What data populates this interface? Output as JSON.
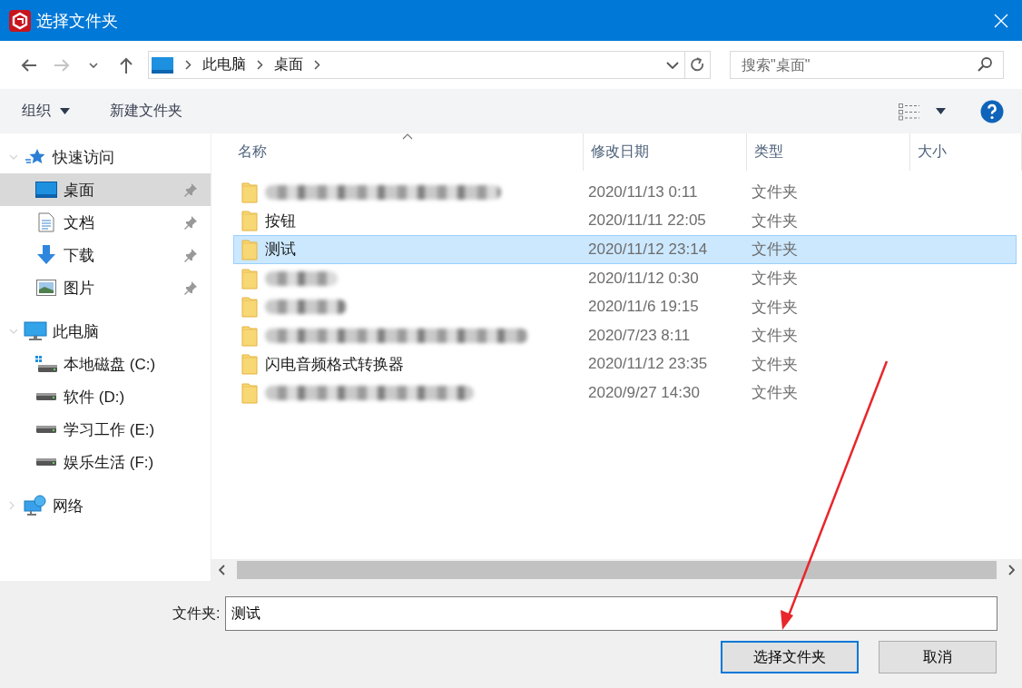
{
  "window": {
    "title": "选择文件夹"
  },
  "navigation": {
    "buttons": [
      {
        "kind": "back",
        "disabled": false
      },
      {
        "kind": "forward",
        "disabled": true
      },
      {
        "kind": "recent",
        "disabled": false
      },
      {
        "kind": "up",
        "disabled": false
      }
    ],
    "breadcrumb": [
      "此电脑",
      "桌面"
    ],
    "search": {
      "placeholder": "搜索\"桌面\""
    }
  },
  "toolbar": {
    "organize": "组织",
    "new_folder": "新建文件夹"
  },
  "sidebar": {
    "items": [
      {
        "label": "快速访问",
        "kind": "quick",
        "expanded": true,
        "selected": false,
        "children": [
          {
            "label": "桌面",
            "kind": "desktop",
            "selected": true,
            "pinned": true
          },
          {
            "label": "文档",
            "kind": "document",
            "selected": false,
            "pinned": true
          },
          {
            "label": "下载",
            "kind": "download",
            "selected": false,
            "pinned": true
          },
          {
            "label": "图片",
            "kind": "picture",
            "selected": false,
            "pinned": true
          }
        ]
      },
      {
        "label": "此电脑",
        "kind": "pc",
        "expanded": true,
        "selected": false,
        "children": [
          {
            "label": "本地磁盘 (C:)",
            "kind": "system-drive",
            "selected": false
          },
          {
            "label": "软件 (D:)",
            "kind": "drive",
            "selected": false
          },
          {
            "label": "学习工作 (E:)",
            "kind": "drive",
            "selected": false
          },
          {
            "label": "娱乐生活 (F:)",
            "kind": "drive",
            "selected": false
          }
        ]
      },
      {
        "label": "网络",
        "kind": "network",
        "expanded": false,
        "selected": false
      }
    ]
  },
  "table": {
    "columns": [
      "名称",
      "修改日期",
      "类型",
      "大小"
    ],
    "rows": [
      {
        "redacted": true,
        "date": "2020/11/13 0:11",
        "type": "文件夹",
        "selected": false
      },
      {
        "name": "按钮",
        "date": "2020/11/11 22:05",
        "type": "文件夹",
        "selected": false
      },
      {
        "name": "测试",
        "date": "2020/11/12 23:14",
        "type": "文件夹",
        "selected": true
      },
      {
        "redacted": true,
        "date": "2020/11/12 0:30",
        "type": "文件夹",
        "selected": false
      },
      {
        "redacted": true,
        "date": "2020/11/6 19:15",
        "type": "文件夹",
        "selected": false
      },
      {
        "redacted": true,
        "date": "2020/7/23 8:11",
        "type": "文件夹",
        "selected": false
      },
      {
        "name": "闪电音频格式转换器",
        "date": "2020/11/12 23:35",
        "type": "文件夹",
        "selected": false
      },
      {
        "redacted": true,
        "date": "2020/9/27 14:30",
        "type": "文件夹",
        "selected": false
      }
    ]
  },
  "footer": {
    "label": "文件夹:",
    "value": "测试",
    "buttons": [
      {
        "label": "选择文件夹",
        "default": true
      },
      {
        "label": "取消",
        "default": false
      }
    ]
  },
  "annotations": [
    {
      "kind": "arrow"
    }
  ]
}
